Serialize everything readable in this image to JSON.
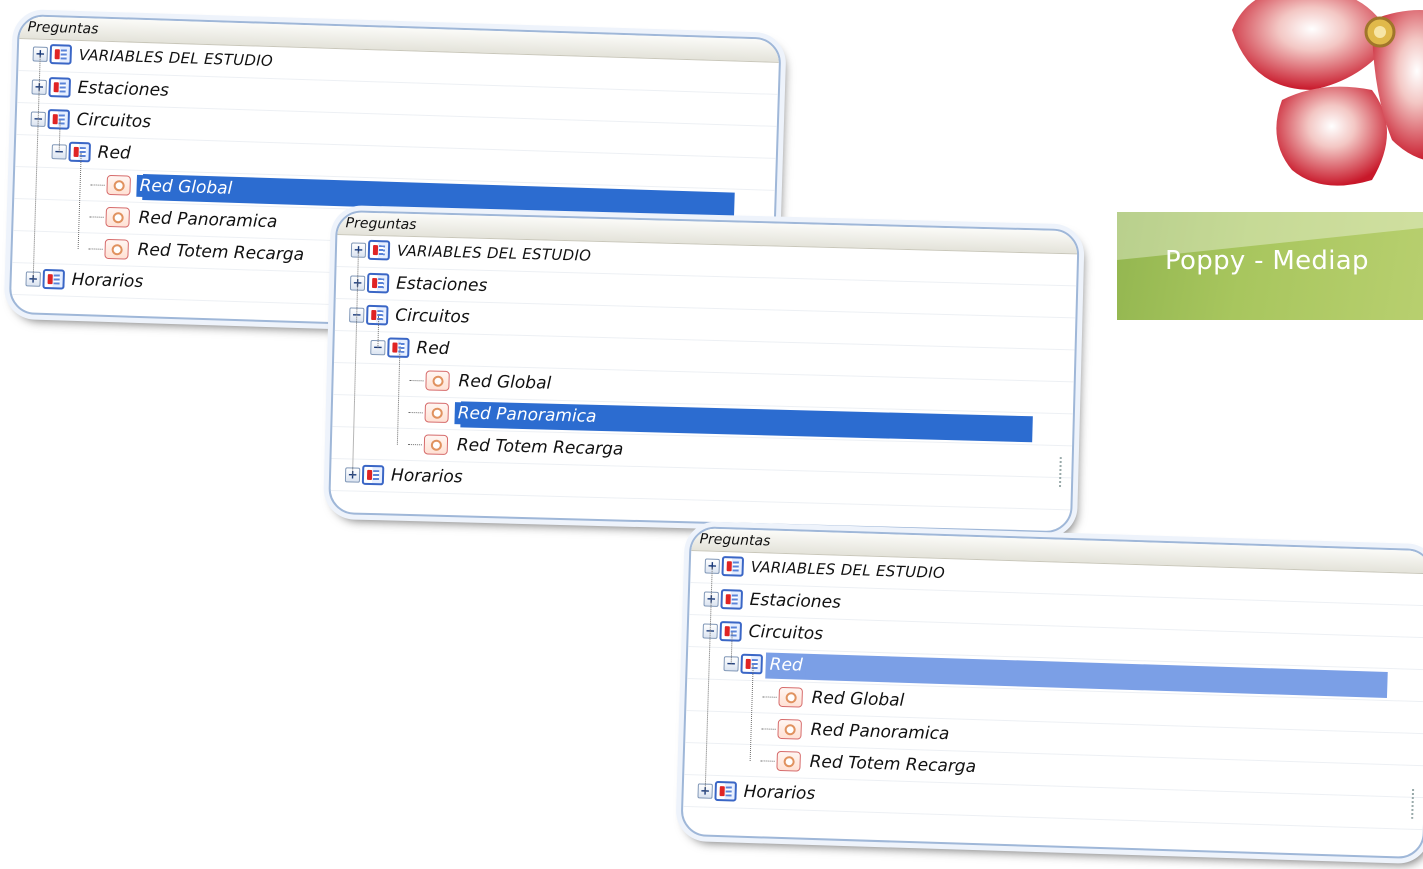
{
  "panels": [
    {
      "header": "Preguntas",
      "items": [
        {
          "label": "VARIABLES DEL ESTUDIO",
          "kind": "folder",
          "expander": "+",
          "level": 0
        },
        {
          "label": "Estaciones",
          "kind": "folder",
          "expander": "+",
          "level": 0
        },
        {
          "label": "Circuitos",
          "kind": "folder",
          "expander": "−",
          "level": 0
        },
        {
          "label": "Red",
          "kind": "folder",
          "expander": "−",
          "level": 1
        },
        {
          "label": "Red Global",
          "kind": "question",
          "level": 2,
          "selected": true
        },
        {
          "label": "Red Panoramica",
          "kind": "question",
          "level": 2
        },
        {
          "label": "Red Totem Recarga",
          "kind": "question",
          "level": 2
        },
        {
          "label": "Horarios",
          "kind": "folder",
          "expander": "+",
          "level": 0
        }
      ]
    },
    {
      "header": "Preguntas",
      "items": [
        {
          "label": "VARIABLES DEL ESTUDIO",
          "kind": "folder",
          "expander": "+",
          "level": 0
        },
        {
          "label": "Estaciones",
          "kind": "folder",
          "expander": "+",
          "level": 0
        },
        {
          "label": "Circuitos",
          "kind": "folder",
          "expander": "−",
          "level": 0
        },
        {
          "label": "Red",
          "kind": "folder",
          "expander": "−",
          "level": 1
        },
        {
          "label": "Red Global",
          "kind": "question",
          "level": 2
        },
        {
          "label": "Red Panoramica",
          "kind": "question",
          "level": 2,
          "selected": true
        },
        {
          "label": "Red Totem Recarga",
          "kind": "question",
          "level": 2
        },
        {
          "label": "Horarios",
          "kind": "folder",
          "expander": "+",
          "level": 0
        }
      ]
    },
    {
      "header": "Preguntas",
      "items": [
        {
          "label": "VARIABLES DEL ESTUDIO",
          "kind": "folder",
          "expander": "+",
          "level": 0
        },
        {
          "label": "Estaciones",
          "kind": "folder",
          "expander": "+",
          "level": 0
        },
        {
          "label": "Circuitos",
          "kind": "folder",
          "expander": "−",
          "level": 0
        },
        {
          "label": "Red",
          "kind": "folder",
          "expander": "−",
          "level": 1,
          "selected_soft": true
        },
        {
          "label": "Red Global",
          "kind": "question",
          "level": 2
        },
        {
          "label": "Red Panoramica",
          "kind": "question",
          "level": 2
        },
        {
          "label": "Red Totem Recarga",
          "kind": "question",
          "level": 2
        },
        {
          "label": "Horarios",
          "kind": "folder",
          "expander": "+",
          "level": 0
        }
      ]
    }
  ],
  "brand": {
    "banner_text": "Poppy - Mediap",
    "banner_color": "#a4c35c",
    "logo_color": "#c8182a"
  },
  "colors": {
    "selection": "#2c6cd0",
    "selection_soft": "#7b9fe6",
    "panel_border": "#9fb7d8"
  }
}
